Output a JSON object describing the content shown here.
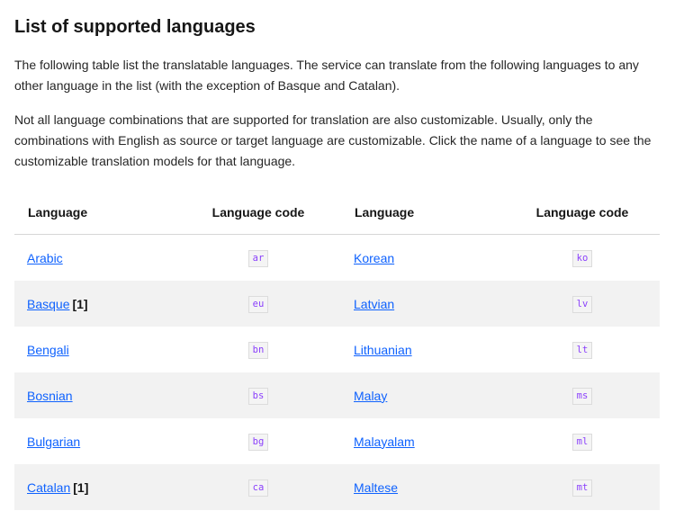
{
  "heading": "List of supported languages",
  "paragraphs": [
    "The following table list the translatable languages. The service can translate from the following languages to any other language in the list (with the exception of Basque and Catalan).",
    "Not all language combinations that are supported for translation are also customizable. Usually, only the combinations with English as source or target language are customizable. Click the name of a language to see the customizable translation models for that language."
  ],
  "table": {
    "headers": [
      "Language",
      "Language code",
      "Language",
      "Language code"
    ],
    "rows": [
      {
        "lang1": "Arabic",
        "note1": "",
        "code1": "ar",
        "lang2": "Korean",
        "code2": "ko"
      },
      {
        "lang1": "Basque",
        "note1": "[1]",
        "code1": "eu",
        "lang2": "Latvian",
        "code2": "lv"
      },
      {
        "lang1": "Bengali",
        "note1": "",
        "code1": "bn",
        "lang2": "Lithuanian",
        "code2": "lt"
      },
      {
        "lang1": "Bosnian",
        "note1": "",
        "code1": "bs",
        "lang2": "Malay",
        "code2": "ms"
      },
      {
        "lang1": "Bulgarian",
        "note1": "",
        "code1": "bg",
        "lang2": "Malayalam",
        "code2": "ml"
      },
      {
        "lang1": "Catalan",
        "note1": "[1]",
        "code1": "ca",
        "lang2": "Maltese",
        "code2": "mt"
      }
    ]
  },
  "colors": {
    "link": "#0f62fe",
    "code_text": "#8a3ffc",
    "stripe": "#f2f2f2"
  }
}
